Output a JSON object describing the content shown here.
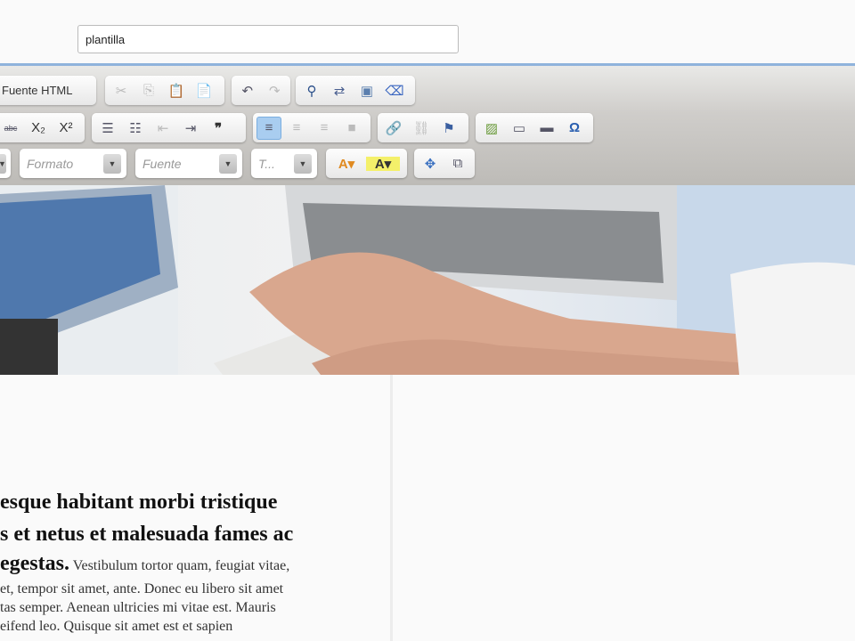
{
  "title_field": {
    "value": "plantilla"
  },
  "toolbar": {
    "source_label": "Fuente HTML",
    "format_placeholder": "Formato",
    "font_placeholder": "Fuente",
    "size_placeholder": "T...",
    "accent": "#a9cdf0"
  },
  "article": {
    "heading_lines": [
      "esque habitant morbi tristique",
      "s et netus et malesuada fames ac"
    ],
    "heading_tail": "egestas.",
    "body_first": " Vestibulum tortor quam, feugiat vitae,",
    "body_lines": [
      "et, tempor sit amet, ante. Donec eu libero sit amet",
      "tas semper. Aenean ultricies mi vitae est. Mauris",
      "eifend leo. Quisque sit amet est et sapien"
    ]
  }
}
